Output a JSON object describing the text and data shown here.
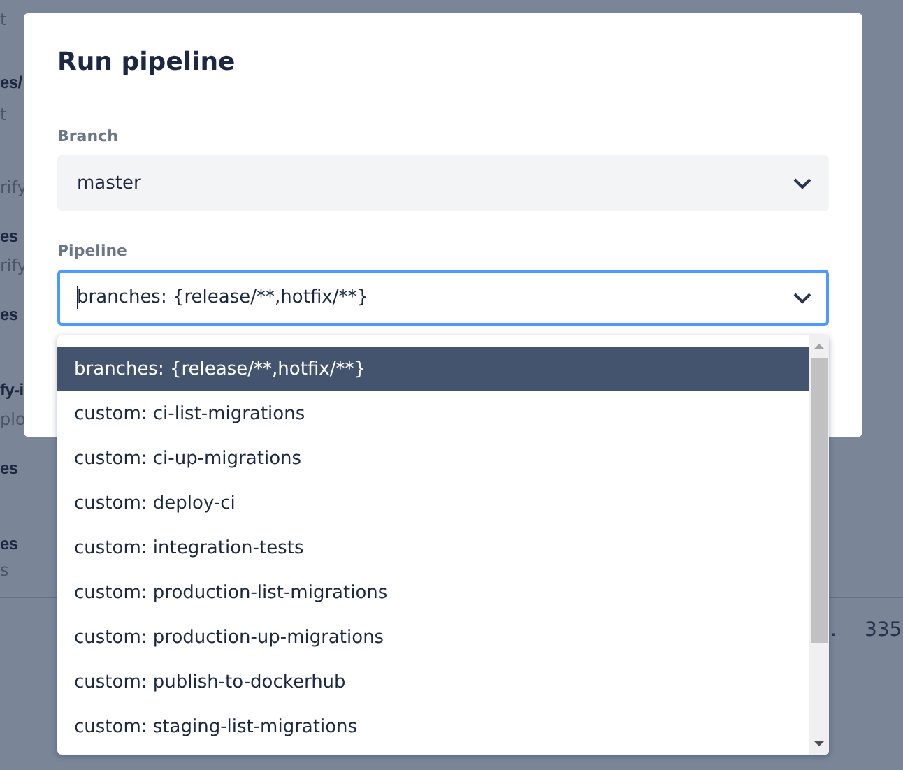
{
  "background": {
    "fragments": [
      {
        "text": "t",
        "kind": "sub"
      },
      {
        "text": "es/",
        "kind": "title"
      },
      {
        "text": "t",
        "kind": "sub"
      },
      {
        "text": "rify",
        "kind": "sub"
      },
      {
        "text": "es",
        "kind": "title"
      },
      {
        "text": "rify",
        "kind": "sub"
      },
      {
        "text": "es",
        "kind": "title"
      },
      {
        "text": "fy-i",
        "kind": "title"
      },
      {
        "text": "plo",
        "kind": "sub"
      },
      {
        "text": "es",
        "kind": "title"
      },
      {
        "text": "es",
        "kind": "title"
      },
      {
        "text": "s",
        "kind": "sub"
      }
    ],
    "row_cells": [
      ".",
      "335"
    ]
  },
  "dialog": {
    "title": "Run pipeline",
    "branch": {
      "label": "Branch",
      "value": "master"
    },
    "pipeline": {
      "label": "Pipeline",
      "value": "branches: {release/**,hotfix/**}",
      "focused": true,
      "options": [
        {
          "label": "branches: {release/**,hotfix/**}",
          "selected": true
        },
        {
          "label": "custom: ci-list-migrations",
          "selected": false
        },
        {
          "label": "custom: ci-up-migrations",
          "selected": false
        },
        {
          "label": "custom: deploy-ci",
          "selected": false
        },
        {
          "label": "custom: integration-tests",
          "selected": false
        },
        {
          "label": "custom: production-list-migrations",
          "selected": false
        },
        {
          "label": "custom: production-up-migrations",
          "selected": false
        },
        {
          "label": "custom: publish-to-dockerhub",
          "selected": false
        },
        {
          "label": "custom: staging-list-migrations",
          "selected": false
        }
      ]
    }
  }
}
